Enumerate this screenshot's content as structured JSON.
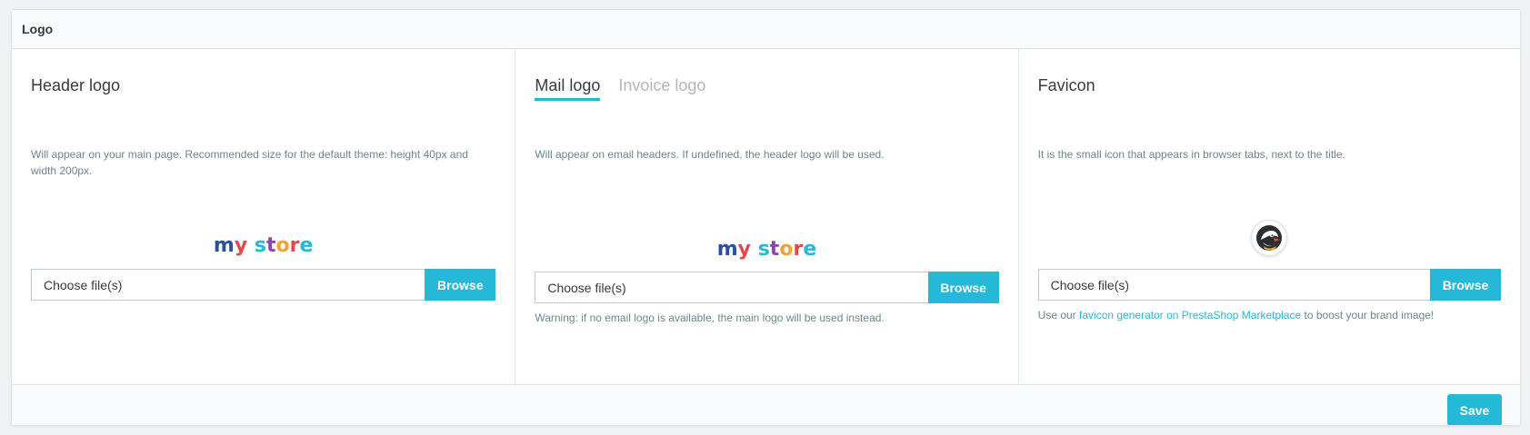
{
  "panel": {
    "title": "Logo",
    "icon": "image-icon"
  },
  "header_logo": {
    "title": "Header logo",
    "description": "Will appear on your main page. Recommended size for the default theme: height 40px and width 200px.",
    "preview_text": "my store",
    "file_placeholder": "Choose file(s)",
    "browse_label": "Browse"
  },
  "mail_invoice": {
    "tabs": [
      {
        "label": "Mail logo",
        "active": true
      },
      {
        "label": "Invoice logo",
        "active": false
      }
    ],
    "description": "Will appear on email headers. If undefined, the header logo will be used.",
    "preview_text": "my store",
    "file_placeholder": "Choose file(s)",
    "browse_label": "Browse",
    "warning": "Warning: if no email logo is available, the main logo will be used instead."
  },
  "favicon": {
    "title": "Favicon",
    "description": "It is the small icon that appears in browser tabs, next to the title.",
    "icon": "prestashop-puffin-icon",
    "file_placeholder": "Choose file(s)",
    "browse_label": "Browse",
    "help_prefix": "Use our ",
    "help_link": "favicon generator on PrestaShop Marketplace",
    "help_suffix": " to boost your brand image!"
  },
  "footer": {
    "save_label": "Save"
  },
  "colors": {
    "accent": "#25b9d7",
    "text": "#363a41",
    "muted": "#6c868e",
    "border": "#bbcdd2"
  }
}
